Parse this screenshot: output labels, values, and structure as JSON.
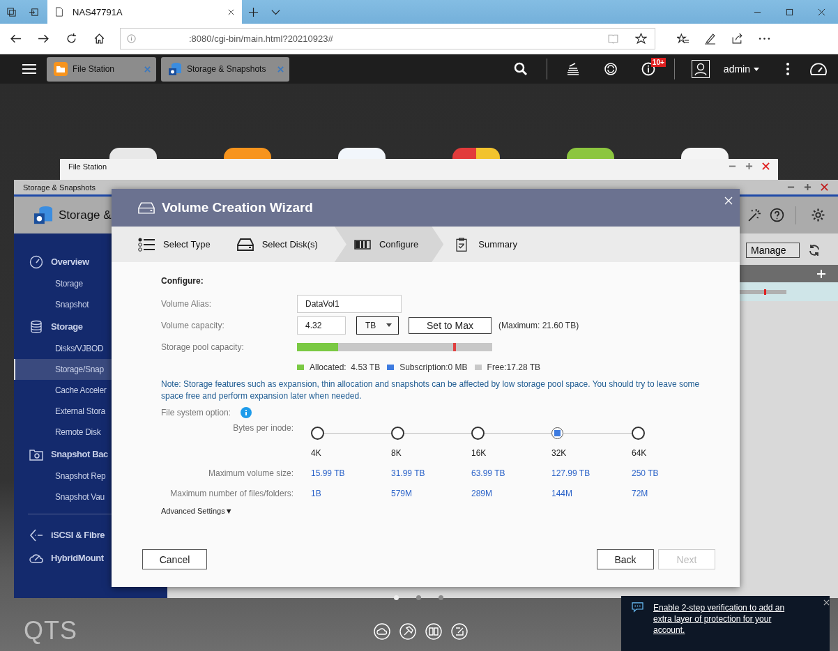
{
  "browser": {
    "tab_title": "NAS47791A",
    "address": ":8080/cgi-bin/main.html?20210923#"
  },
  "topbar": {
    "apps": [
      {
        "label": "File Station",
        "kind": "folder"
      },
      {
        "label": "Storage & Snapshots",
        "kind": "storage"
      }
    ],
    "notification_badge": "10+",
    "user": "admin"
  },
  "file_station_window": {
    "title": "File Station"
  },
  "storage_window": {
    "title": "Storage & Snapshots",
    "header": "Storage &",
    "manage_button": "Manage",
    "sidebar": [
      {
        "label": "Overview",
        "kind": "overview",
        "children": [
          {
            "label": "Storage",
            "selected": false
          },
          {
            "label": "Snapshot",
            "selected": false
          }
        ]
      },
      {
        "label": "Storage",
        "kind": "storage",
        "children": [
          {
            "label": "Disks/VJBOD",
            "selected": false
          },
          {
            "label": "Storage/Snap",
            "selected": true
          },
          {
            "label": "Cache Acceler",
            "selected": false
          },
          {
            "label": "External Stora",
            "selected": false
          },
          {
            "label": "Remote Disk",
            "selected": false
          }
        ]
      },
      {
        "label": "Snapshot Bac",
        "kind": "snapshot",
        "children": [
          {
            "label": "Snapshot Rep",
            "selected": false
          },
          {
            "label": "Snapshot Vau",
            "selected": false
          }
        ]
      },
      {
        "label": "iSCSI & Fibre",
        "kind": "iscsi"
      },
      {
        "label": "HybridMount",
        "kind": "cloud"
      }
    ]
  },
  "wizard": {
    "title": "Volume Creation Wizard",
    "steps": [
      {
        "label": "Select Type",
        "selected": false
      },
      {
        "label": "Select Disk(s)",
        "selected": false
      },
      {
        "label": "Configure",
        "selected": true
      },
      {
        "label": "Summary",
        "selected": false
      }
    ],
    "section_title": "Configure:",
    "alias": {
      "label": "Volume Alias:",
      "value": "DataVol1"
    },
    "capacity": {
      "label": "Volume capacity:",
      "value": "4.32",
      "unit": "TB",
      "set_max": "Set to Max",
      "maximum": "(Maximum: 21.60 TB)"
    },
    "pool": {
      "label": "Storage pool capacity:",
      "level": 0.21
    },
    "legend": [
      {
        "label": "Allocated:  4.53 TB",
        "color": "#7ac943"
      },
      {
        "label": "Subscription:0 MB",
        "color": "#3d7be0"
      },
      {
        "label": "Free:17.28 TB",
        "color": "#c8c8c8"
      }
    ],
    "note": "Note: Storage features such as expansion, thin allocation and snapshots can be affected by low storage pool space. You should try to leave some space free and perform expansion later when needed.",
    "fs_option_label": "File system option:",
    "inode_label": "Bytes per inode:",
    "max_size_label": "Maximum volume size:",
    "max_files_label": "Maximum number of files/folders:",
    "inode_options": [
      {
        "label": "4K",
        "max_size": "15.99 TB",
        "max_files": "1B",
        "selected": false
      },
      {
        "label": "8K",
        "max_size": "31.99 TB",
        "max_files": "579M",
        "selected": false
      },
      {
        "label": "16K",
        "max_size": "63.99 TB",
        "max_files": "289M",
        "selected": false
      },
      {
        "label": "32K",
        "max_size": "127.99 TB",
        "max_files": "144M",
        "selected": true
      },
      {
        "label": "64K",
        "max_size": "250 TB",
        "max_files": "72M",
        "selected": false
      }
    ],
    "advanced": "Advanced Settings▼",
    "buttons": {
      "cancel": "Cancel",
      "back": "Back",
      "next": "Next",
      "next_disabled": true
    }
  },
  "bottom": {
    "logo": "QTS",
    "notice": "Enable 2-step verification to add an extra layer of protection for your account."
  }
}
